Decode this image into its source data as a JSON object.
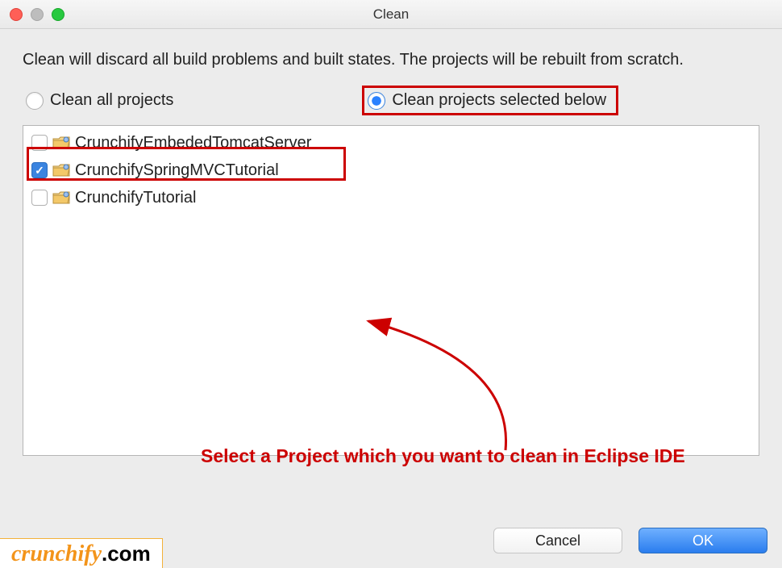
{
  "window": {
    "title": "Clean"
  },
  "description": "Clean will discard all build problems and built states.  The projects will be rebuilt from scratch.",
  "radios": {
    "clean_all": "Clean all projects",
    "clean_selected": "Clean projects selected below"
  },
  "projects": [
    {
      "name": "CrunchifyEmbededTomcatServer",
      "checked": false
    },
    {
      "name": "CrunchifySpringMVCTutorial",
      "checked": true
    },
    {
      "name": "CrunchifyTutorial",
      "checked": false
    }
  ],
  "annotation": "Select a Project which you want to clean in Eclipse IDE",
  "buttons": {
    "cancel": "Cancel",
    "ok": "OK"
  },
  "watermark": {
    "brand": "crunchify",
    "suffix": ".com"
  },
  "colors": {
    "highlight": "#cc0000",
    "accent": "#2a7dee"
  }
}
